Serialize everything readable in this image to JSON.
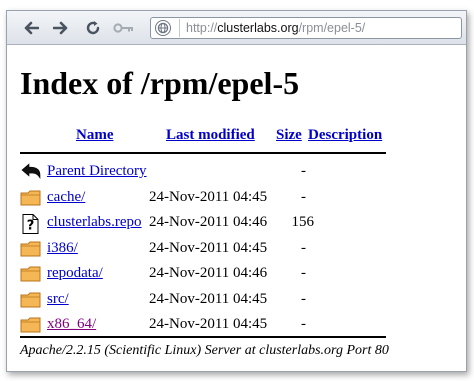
{
  "browser": {
    "url_scheme": "http://",
    "url_host": "clusterlabs.org",
    "url_path": "/rpm/epel-5/",
    "back_glyph": "➔",
    "forward_glyph": "➔",
    "reload_glyph": "↻",
    "key_glyph": "⚿",
    "globe_glyph": "●"
  },
  "page": {
    "title": "Index of /rpm/epel-5"
  },
  "table": {
    "headers": {
      "name": "Name",
      "last_modified": "Last modified",
      "size": "Size",
      "description": "Description"
    },
    "rows": [
      {
        "icon": "back-arrow-icon",
        "name": "Parent Directory",
        "date": "",
        "size": "-",
        "visited": false
      },
      {
        "icon": "folder-icon",
        "name": "cache/",
        "date": "24-Nov-2011 04:45",
        "size": "-",
        "visited": false
      },
      {
        "icon": "unknown-file-icon",
        "name": "clusterlabs.repo",
        "date": "24-Nov-2011 04:46",
        "size": "156",
        "visited": false
      },
      {
        "icon": "folder-icon",
        "name": "i386/",
        "date": "24-Nov-2011 04:45",
        "size": "-",
        "visited": false
      },
      {
        "icon": "folder-icon",
        "name": "repodata/",
        "date": "24-Nov-2011 04:46",
        "size": "-",
        "visited": false
      },
      {
        "icon": "folder-icon",
        "name": "src/",
        "date": "24-Nov-2011 04:45",
        "size": "-",
        "visited": false
      },
      {
        "icon": "folder-icon",
        "name": "x86_64/",
        "date": "24-Nov-2011 04:45",
        "size": "-",
        "visited": true
      }
    ]
  },
  "footer": {
    "server_signature": "Apache/2.2.15 (Scientific Linux) Server at clusterlabs.org Port 80"
  },
  "colors": {
    "link": "#0000cc",
    "visited_link": "#800080",
    "folder_fill": "#f5b655",
    "folder_stroke": "#b8761b"
  }
}
